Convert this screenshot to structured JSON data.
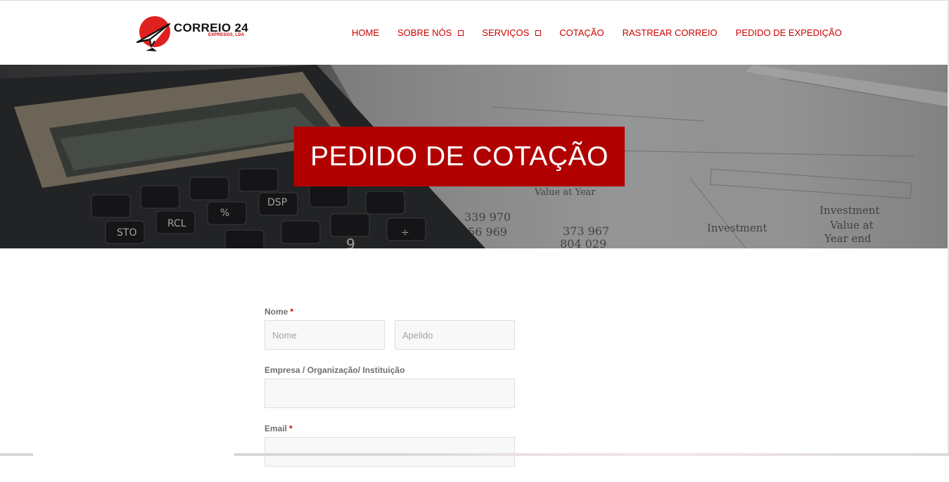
{
  "brand": {
    "name": "CORREIO 24",
    "subtitle": "EXPRESSO, LDA"
  },
  "nav": {
    "items": [
      {
        "label": "HOME",
        "has_dropdown": false
      },
      {
        "label": "SOBRE NÓS",
        "has_dropdown": true
      },
      {
        "label": "SERVIÇOS",
        "has_dropdown": true
      },
      {
        "label": "COTAÇÃO",
        "has_dropdown": false
      },
      {
        "label": "RASTREAR CORREIO",
        "has_dropdown": false
      },
      {
        "label": "PEDIDO DE EXPEDIÇÃO",
        "has_dropdown": false
      }
    ]
  },
  "hero": {
    "title": "PEDIDO DE COTAÇÃO"
  },
  "form": {
    "name_label": "Nome",
    "required_mark": "*",
    "first_name_placeholder": "Nome",
    "last_name_placeholder": "Apelido",
    "company_label": "Empresa / Organização/ Instituição",
    "email_label": "Email"
  },
  "colors": {
    "accent": "#cc0000",
    "hero_banner": "#b10000",
    "label": "#6f6f6f",
    "input_bg": "#f8f8f8"
  }
}
